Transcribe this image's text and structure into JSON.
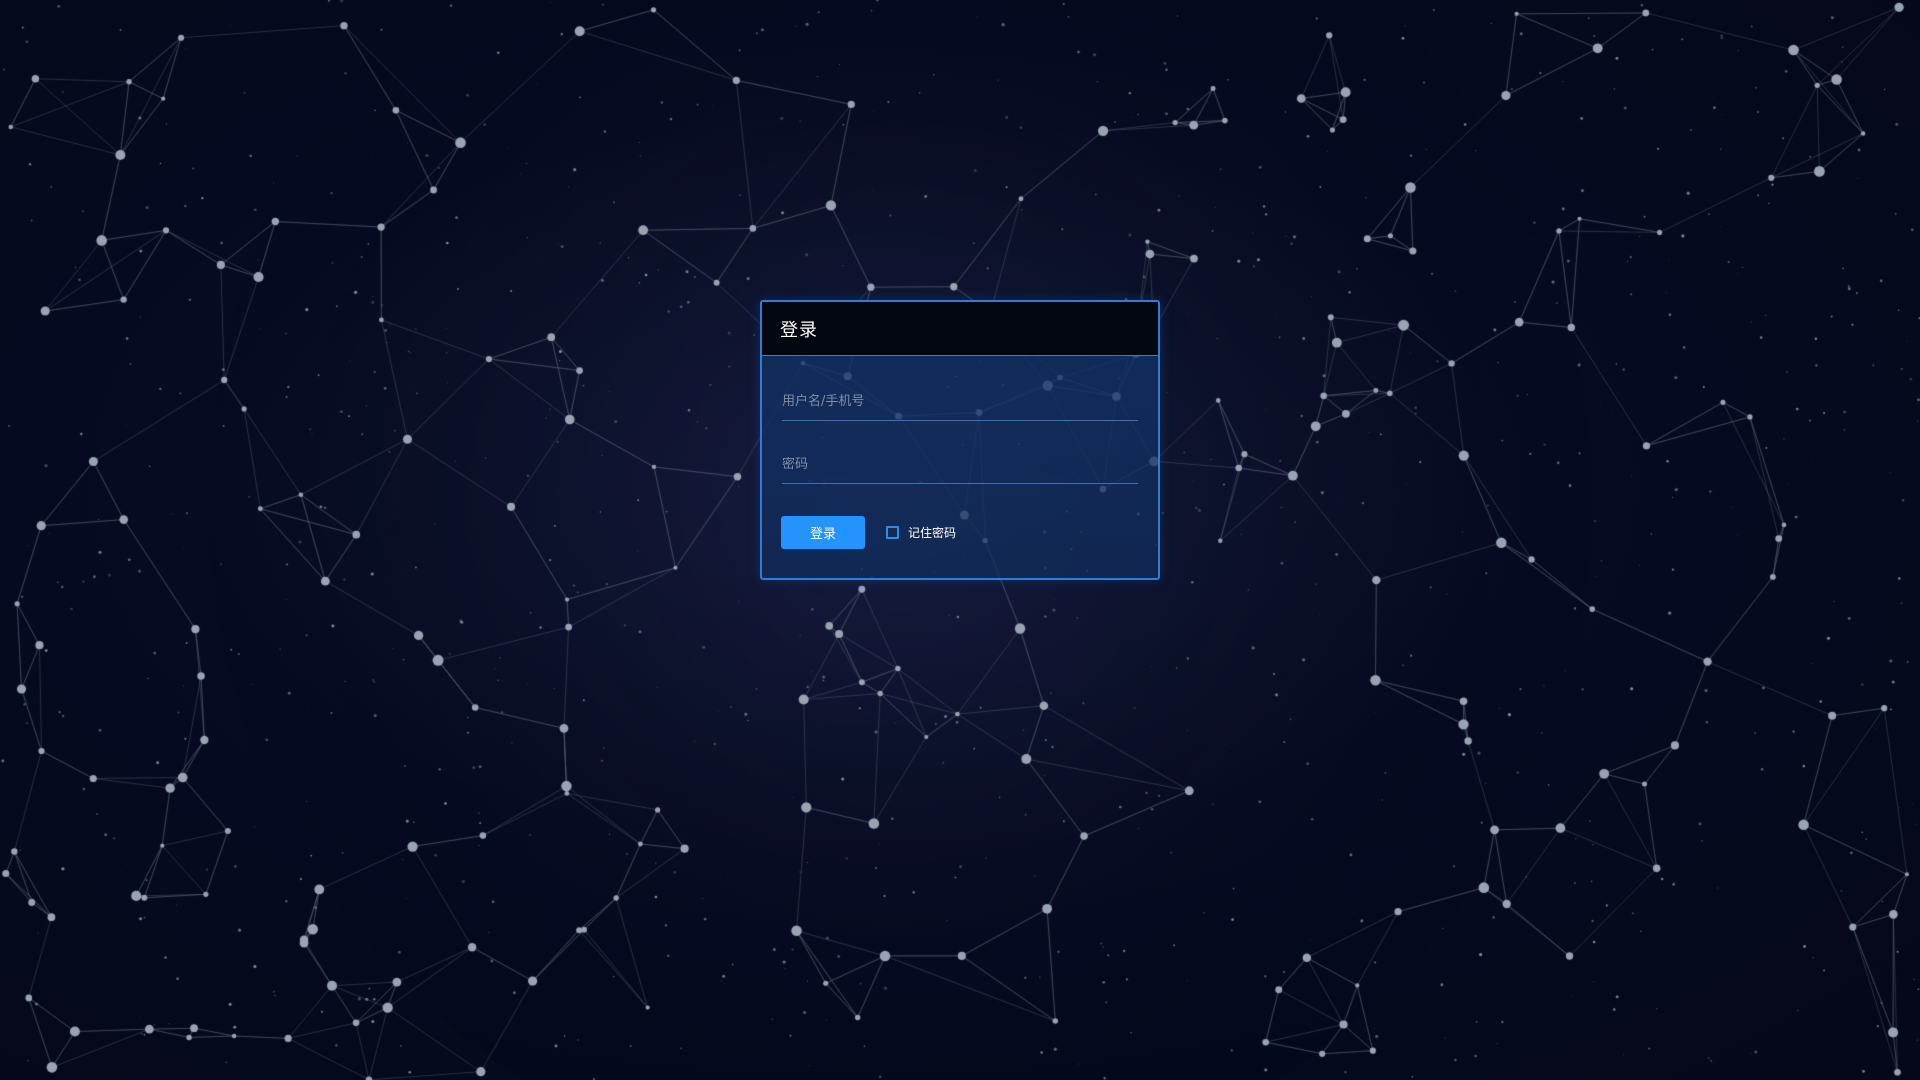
{
  "login": {
    "title": "登录",
    "username_placeholder": "用户名/手机号",
    "password_placeholder": "密码",
    "submit_label": "登录",
    "remember_label": "记住密码",
    "remember_checked": false
  },
  "theme": {
    "background": "#050a1f",
    "accent": "#2593fc",
    "panel_border": "#2d7fd6",
    "node_color": "#9aa3b4",
    "line_color": "#5a6275"
  }
}
